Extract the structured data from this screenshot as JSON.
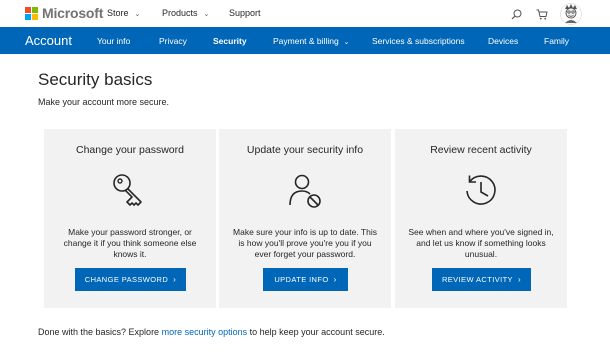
{
  "brand": {
    "name": "Microsoft"
  },
  "topnav": [
    {
      "label": "Store",
      "has_dropdown": true
    },
    {
      "label": "Products",
      "has_dropdown": true
    },
    {
      "label": "Support",
      "has_dropdown": false
    }
  ],
  "topicons": {
    "search": "search-icon",
    "cart": "cart-icon",
    "avatar": "avatar"
  },
  "account_nav": {
    "title": "Account",
    "items": [
      {
        "label": "Your info",
        "active": false,
        "has_dropdown": false
      },
      {
        "label": "Privacy",
        "active": false,
        "has_dropdown": false
      },
      {
        "label": "Security",
        "active": true,
        "has_dropdown": false
      },
      {
        "label": "Payment & billing",
        "active": false,
        "has_dropdown": true
      },
      {
        "label": "Services & subscriptions",
        "active": false,
        "has_dropdown": false
      },
      {
        "label": "Devices",
        "active": false,
        "has_dropdown": false
      },
      {
        "label": "Family",
        "active": false,
        "has_dropdown": false
      }
    ]
  },
  "page": {
    "title": "Security basics",
    "subtitle": "Make your account more secure."
  },
  "cards": [
    {
      "title": "Change your password",
      "icon": "key-icon",
      "description": "Make your password stronger, or change it if you think someone else knows it.",
      "button": "CHANGE PASSWORD"
    },
    {
      "title": "Update your security info",
      "icon": "user-blocked-icon",
      "description": "Make sure your info is up to date. This is how you'll prove you're you if you ever forget your password.",
      "button": "UPDATE INFO"
    },
    {
      "title": "Review recent activity",
      "icon": "history-icon",
      "description": "See when and where you've signed in, and let us know if something looks unusual.",
      "button": "REVIEW ACTIVITY"
    }
  ],
  "footer": {
    "prefix": "Done with the basics? Explore ",
    "link": "more security options",
    "suffix": " to help keep your account secure."
  },
  "colors": {
    "accent": "#0067b8",
    "card_bg": "#f2f2f2",
    "brand_text": "#737373"
  }
}
